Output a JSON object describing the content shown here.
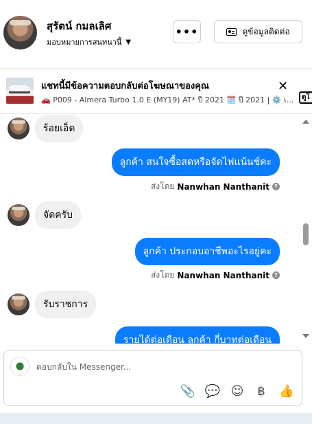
{
  "header": {
    "contact_name": "สุรัตน์ กมลเลิศ",
    "assign_label": "มอบหมายการสนทนานี้",
    "more_label": "•••",
    "contact_info_label": "ดูข้อมูลติดต่อ"
  },
  "ad_banner": {
    "title": "แชทนี้มีข้อความตอบกลับต่อโฆษณาของคุณ",
    "subtitle": "🚗 P009 - Almera Turbo 1.0 E (MY19) AT* ปี 2021 🗓️ ปี 2021 | ⚙️ เ...",
    "close_label": "✕",
    "open_label": "ดูโ"
  },
  "messages": [
    {
      "direction": "in",
      "text": "ร้อยเอ็ด"
    },
    {
      "direction": "out",
      "text": "ลูกค้า  สนใจซื้อสดหรือจัดไฟแน้นช์คะ",
      "sent_by_prefix": "ส่งโดย",
      "sent_by_name": "Nanwhan Nanthanit"
    },
    {
      "direction": "in",
      "text": "จัดครับ"
    },
    {
      "direction": "out",
      "text": "ลูกค้า  ประกอบอาชีพอะไรอยู่คะ",
      "sent_by_prefix": "ส่งโดย",
      "sent_by_name": "Nanwhan Nanthanit"
    },
    {
      "direction": "in",
      "text": "รับราชการ"
    },
    {
      "direction": "out",
      "text": "รายได้ต่อเดือน  ลูกค้า  กี่บาทต่อเดือน"
    }
  ],
  "composer": {
    "placeholder": "ตอบกลับใน Messenger...",
    "tools": {
      "attach": "📎",
      "saved_reply": "💬",
      "emoji": "☺",
      "payment": "฿",
      "like": "👍"
    }
  },
  "colors": {
    "accent": "#0a7cff",
    "incoming_bubble": "#f0f0f0",
    "muted_text": "#65676b"
  }
}
